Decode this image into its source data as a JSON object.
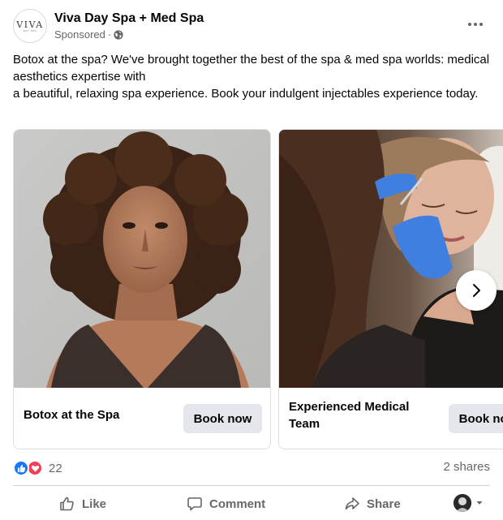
{
  "post": {
    "page_name": "Viva Day Spa + Med Spa",
    "sponsored_label": "Sponsored",
    "separator": "·",
    "logo_text": "VIVA",
    "logo_subtext": "DAY SPA",
    "text_lines": [
      "Botox at the spa? We've brought together the best of the spa & med spa worlds: medical aesthetics expertise with",
      "a beautiful, relaxing spa experience. Book your indulgent injectables experience today."
    ]
  },
  "carousel": {
    "cards": [
      {
        "title": "Botox at the Spa",
        "button_label": "Book now"
      },
      {
        "title": "Experienced Medical Team",
        "button_label": "Book now"
      }
    ]
  },
  "engagement": {
    "reaction_count": "22",
    "shares": "2 shares",
    "reaction_icons": [
      "like-icon",
      "love-icon"
    ]
  },
  "actions": {
    "like": "Like",
    "comment": "Comment",
    "share": "Share"
  },
  "colors": {
    "brand_blue": "#1877f2",
    "love_red": "#f33e58",
    "secondary_text": "#65676b",
    "button_bg": "#e4e6eb"
  }
}
